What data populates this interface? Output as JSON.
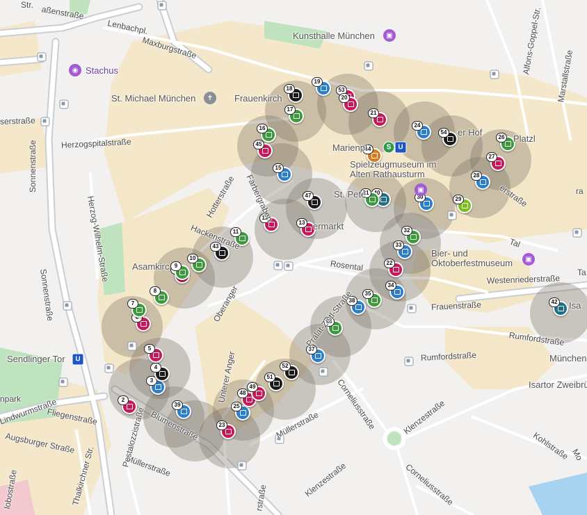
{
  "map": {
    "streets": [
      {
        "id": "st-lenbachpl",
        "text": "Lenbachpl."
      },
      {
        "id": "st-maxburg",
        "text": "Maxburgstraße"
      },
      {
        "id": "st-herzogspital",
        "text": "Herzogspitalstraße"
      },
      {
        "id": "st-sonnen1",
        "text": "Sonnenstraße"
      },
      {
        "id": "st-sonnen2",
        "text": "Sonnenstraße"
      },
      {
        "id": "st-herzogwilhelm",
        "text": "Herzog-Wilhelm-Straße"
      },
      {
        "id": "st-hotter",
        "text": "Hotterstraße"
      },
      {
        "id": "st-faerber",
        "text": "Färbergraben"
      },
      {
        "id": "st-hacken",
        "text": "Hackenstraße"
      },
      {
        "id": "st-oberanger",
        "text": "Oberanger"
      },
      {
        "id": "st-rosental",
        "text": "Rosental"
      },
      {
        "id": "st-unteranger",
        "text": "Unterer Anger"
      },
      {
        "id": "st-praelat",
        "text": "Prälat-Zistl-Straße"
      },
      {
        "id": "st-frauen",
        "text": "Frauenstraße"
      },
      {
        "id": "st-rumford1",
        "text": "Rumfordstraße"
      },
      {
        "id": "st-rumford2",
        "text": "Rumfordstraße"
      },
      {
        "id": "st-westenrieder",
        "text": "Westenriederstraße"
      },
      {
        "id": "st-tal",
        "text": "Tal"
      },
      {
        "id": "st-corneli1",
        "text": "Corneliusstraße"
      },
      {
        "id": "st-corneli2",
        "text": "Corneliusstraße"
      },
      {
        "id": "st-klenze1",
        "text": "Klenzestraße"
      },
      {
        "id": "st-klenze2",
        "text": "Klenzestraße"
      },
      {
        "id": "st-mueller1",
        "text": "Müllerstraße"
      },
      {
        "id": "st-mueller2",
        "text": "Müllerstraße"
      },
      {
        "id": "st-blumen",
        "text": "Blumenstraße"
      },
      {
        "id": "st-fliegen",
        "text": "Fliegenstraße"
      },
      {
        "id": "st-augsburger",
        "text": "Augsburger Straße"
      },
      {
        "id": "st-pestalozzi",
        "text": "Pestalozzistraße"
      },
      {
        "id": "st-thalkirchner",
        "text": "Thalkirchner Str."
      },
      {
        "id": "st-lindwurm",
        "text": "Lindwurmstraße"
      },
      {
        "id": "st-kohl",
        "text": "Kohlstraße"
      },
      {
        "id": "st-marstall",
        "text": "Marstallstraße"
      },
      {
        "id": "st-alfonsgoppel",
        "text": "Alfons-Goppel-Str."
      },
      {
        "id": "st-senserstr",
        "text": "serstraße"
      },
      {
        "id": "st-bayer",
        "text": "aßenstraße"
      },
      {
        "id": "st-tall",
        "text": "Ta"
      },
      {
        "id": "st-platzl",
        "text": "Platzl"
      },
      {
        "id": "st-isartor",
        "text": "Isartor Zweibrüc"
      },
      {
        "id": "st-muenchen",
        "text": "München,"
      },
      {
        "id": "st-park",
        "text": "npark"
      },
      {
        "id": "st-ra",
        "text": "ra"
      },
      {
        "id": "st-isa",
        "text": "Isa"
      },
      {
        "id": "st-mo",
        "text": "Mo"
      },
      {
        "id": "st-obo",
        "text": "lobostraße"
      },
      {
        "id": "st-rstraße",
        "text": "rstraße"
      },
      {
        "id": "st-erer",
        "text": "erstraße"
      },
      {
        "id": "st-ermarkt",
        "text": "ermarkt"
      },
      {
        "id": "st-tr",
        "text": "Str."
      }
    ],
    "places": [
      {
        "id": "pl-kunsthalle",
        "text": "Kunsthalle München",
        "icon": "museum-icon"
      },
      {
        "id": "pl-stachus",
        "text": "Stachus",
        "icon": "camera-icon"
      },
      {
        "id": "pl-michael",
        "text": "St. Michael München",
        "icon": "church-icon"
      },
      {
        "id": "pl-frauenkirche",
        "text": "Frauenkirch"
      },
      {
        "id": "pl-marienplatz",
        "text": "Marienpl"
      },
      {
        "id": "pl-spielzeug",
        "text": "Spielzeugmuseum im Alten Rathausturm",
        "icon": "museum-icon"
      },
      {
        "id": "pl-stpeter",
        "text": "St. Pete"
      },
      {
        "id": "pl-bier",
        "text": "Bier- und Oktoberfestmuseum",
        "icon": "museum-icon"
      },
      {
        "id": "pl-asamkirche",
        "text": "Asamkirc"
      },
      {
        "id": "pl-sendlinger",
        "text": "Sendlinger Tor",
        "icon": "ubahn-icon"
      },
      {
        "id": "pl-hof",
        "text": "er Hof"
      }
    ],
    "transit": {
      "ubahn": "U",
      "sbahn": "S"
    },
    "colors": {
      "green": "#3c9a3c",
      "magenta": "#c8185a",
      "blue": "#2b7ec8",
      "black": "#1b1b1b",
      "teal": "#1f6f86",
      "orange": "#d97a1b",
      "lime": "#7bbf1e"
    },
    "markers": [
      {
        "n": "2",
        "color": "magenta"
      },
      {
        "n": "3",
        "color": "blue"
      },
      {
        "n": "4",
        "color": "black"
      },
      {
        "n": "5",
        "color": "magenta"
      },
      {
        "n": "6",
        "color": "magenta"
      },
      {
        "n": "7",
        "color": "green"
      },
      {
        "n": "8",
        "color": "green"
      },
      {
        "n": "10",
        "color": "green"
      },
      {
        "n": "11",
        "color": "green"
      },
      {
        "n": "12",
        "color": "magenta"
      },
      {
        "n": "13",
        "color": "magenta"
      },
      {
        "n": "15",
        "color": "blue"
      },
      {
        "n": "16",
        "color": "green"
      },
      {
        "n": "17",
        "color": "green"
      },
      {
        "n": "18",
        "color": "black"
      },
      {
        "n": "19",
        "color": "blue"
      },
      {
        "n": "21",
        "color": "magenta"
      },
      {
        "n": "22",
        "color": "magenta"
      },
      {
        "n": "23",
        "color": "magenta"
      },
      {
        "n": "24",
        "color": "blue"
      },
      {
        "n": "25",
        "color": "blue"
      },
      {
        "n": "26",
        "color": "green"
      },
      {
        "n": "27",
        "color": "magenta"
      },
      {
        "n": "28",
        "color": "blue"
      },
      {
        "n": "29",
        "color": "lime"
      },
      {
        "n": "30",
        "color": "blue"
      },
      {
        "n": "32",
        "color": "green"
      },
      {
        "n": "33",
        "color": "blue"
      },
      {
        "n": "34",
        "color": "blue"
      },
      {
        "n": "35",
        "color": "green"
      },
      {
        "n": "36",
        "color": "green"
      },
      {
        "n": "37",
        "color": "blue"
      },
      {
        "n": "38",
        "color": "blue"
      },
      {
        "n": "39",
        "color": "blue"
      },
      {
        "n": "40",
        "color": "teal"
      },
      {
        "n": "42",
        "color": "teal"
      },
      {
        "n": "43",
        "color": "black"
      },
      {
        "n": "44",
        "color": "orange"
      },
      {
        "n": "45",
        "color": "magenta"
      },
      {
        "n": "46",
        "color": "magenta"
      },
      {
        "n": "47",
        "color": "black"
      },
      {
        "n": "48",
        "color": "magenta"
      },
      {
        "n": "49",
        "color": "magenta"
      },
      {
        "n": "51",
        "color": "black"
      },
      {
        "n": "52",
        "color": "black"
      },
      {
        "n": "53",
        "color": "magenta"
      },
      {
        "n": "54",
        "color": "black"
      },
      {
        "n": "9",
        "color": "green"
      },
      {
        "n": "20",
        "color": "magenta"
      },
      {
        "n": "31",
        "color": "green"
      }
    ]
  }
}
